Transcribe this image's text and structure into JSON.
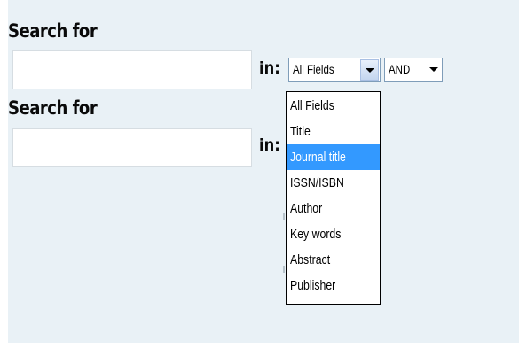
{
  "row1": {
    "label": "Search for",
    "input_value": "",
    "in_label": "in:",
    "field_select": "All Fields",
    "operator_select": "AND"
  },
  "row2": {
    "label": "Search for",
    "input_value": "",
    "in_label": "in:"
  },
  "dropdown": {
    "options": [
      "All Fields",
      "Title",
      "Journal title",
      "ISSN/ISBN",
      "Author",
      "Key words",
      "Abstract",
      "Publisher"
    ],
    "highlighted": "Journal title"
  },
  "colors": {
    "panel_background": "#e9f1f6",
    "highlight": "#3399ff"
  }
}
